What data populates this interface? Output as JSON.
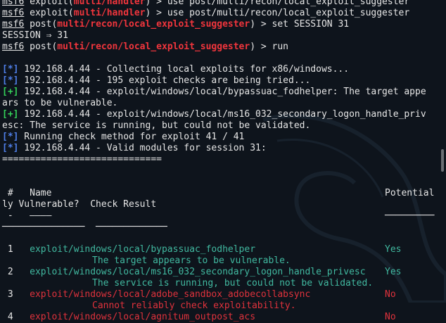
{
  "terminal": {
    "top_partial": "                  multi/handler) > use post/multi/recon/local_exploit_suggester",
    "cmd1": {
      "prompt": "msf6",
      "verb": " exploit(",
      "module": "multi/handler",
      "rest": ") > use post/multi/recon/local_exploit_suggester"
    },
    "cmd2": {
      "prompt": "msf6",
      "verb": " post(",
      "module": "multi/recon/local_exploit_suggester",
      "rest": ") > set SESSION 31"
    },
    "session_line": "SESSION ⇒ 31",
    "cmd3": {
      "prompt": "msf6",
      "verb": " post(",
      "module": "multi/recon/local_exploit_suggester",
      "rest": ") > run"
    },
    "output": [
      {
        "tag": "[*]",
        "color": "blue",
        "text": " 192.168.4.44 - Collecting local exploits for x86/windows..."
      },
      {
        "tag": "[*]",
        "color": "blue",
        "text": " 192.168.4.44 - 195 exploit checks are being tried..."
      },
      {
        "tag": "[+]",
        "color": "green",
        "text": " 192.168.4.44 - exploit/windows/local/bypassuac_fodhelper: The target appe"
      },
      {
        "tag": "",
        "color": "",
        "text": "ars to be vulnerable."
      },
      {
        "tag": "[+]",
        "color": "green",
        "text": " 192.168.4.44 - exploit/windows/local/ms16_032_secondary_logon_handle_priv"
      },
      {
        "tag": "",
        "color": "",
        "text": "esc: The service is running, but could not be validated."
      },
      {
        "tag": "[*]",
        "color": "blue",
        "text": " Running check method for exploit 41 / 41"
      },
      {
        "tag": "[*]",
        "color": "blue",
        "text": " 192.168.4.44 - Valid modules for session 31:"
      }
    ],
    "table_rule": "=============================",
    "headers": {
      "line1_num": " #",
      "line1_name": "   Name",
      "line1_potential": "Potential",
      "line2": "ly Vulnerable?  Check Result",
      "line3_dash": " -   ————",
      "line4_rule": "───────────────  ─────────────",
      "potential_rule": "─────────"
    },
    "rows": [
      {
        "num": " 1",
        "name": "exploit/windows/local/bypassuac_fodhelper",
        "result": "Yes",
        "detail": "The target appears to be vulnerable.",
        "ok": true
      },
      {
        "num": " 2",
        "name": "exploit/windows/local/ms16_032_secondary_logon_handle_privesc",
        "result": "Yes",
        "detail": "The service is running, but could not be validated.",
        "ok": true
      },
      {
        "num": " 3",
        "name": "exploit/windows/local/adobe_sandbox_adobecollabsync",
        "result": "No",
        "detail": "Cannot reliably check exploitability.",
        "ok": false
      },
      {
        "num": " 4",
        "name": "exploit/windows/local/agnitum_outpost_acs",
        "result": "No",
        "detail": "",
        "ok": false
      }
    ]
  },
  "colors": {
    "background": "#0e141c",
    "prompt_module": "#f0353c",
    "info_tag": "#4f7fe8",
    "success_tag": "#34d058",
    "yes_row": "#41b9a0",
    "no_row": "#e0323c"
  }
}
